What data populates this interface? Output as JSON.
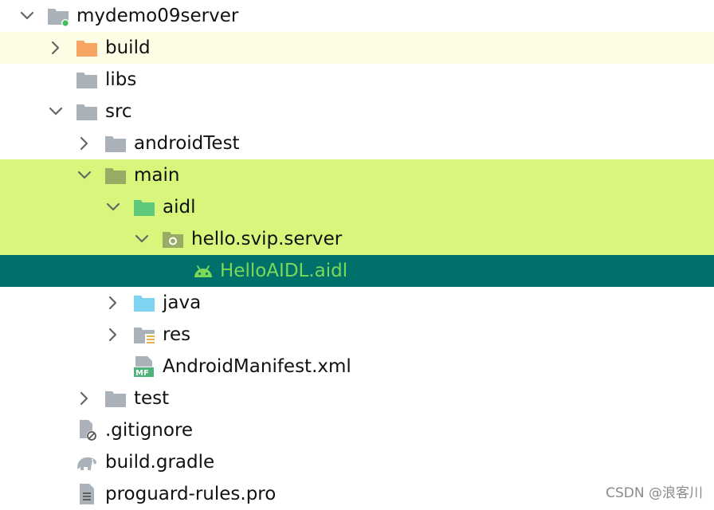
{
  "tree": {
    "rows": [
      {
        "label": "mydemo09server",
        "icon": "module-folder-icon",
        "state": "expanded"
      },
      {
        "label": "build",
        "icon": "folder-excluded-icon",
        "state": "collapsed"
      },
      {
        "label": "libs",
        "icon": "folder-icon",
        "state": "none"
      },
      {
        "label": "src",
        "icon": "folder-icon",
        "state": "expanded"
      },
      {
        "label": "androidTest",
        "icon": "folder-icon",
        "state": "collapsed"
      },
      {
        "label": "main",
        "icon": "folder-icon",
        "state": "expanded"
      },
      {
        "label": "aidl",
        "icon": "aidl-source-folder-icon",
        "state": "expanded"
      },
      {
        "label": "hello.svip.server",
        "icon": "package-icon",
        "state": "expanded"
      },
      {
        "label": "HelloAIDL.aidl",
        "icon": "android-icon",
        "state": "none",
        "selected": true
      },
      {
        "label": "java",
        "icon": "java-source-folder-icon",
        "state": "collapsed"
      },
      {
        "label": "res",
        "icon": "resources-folder-icon",
        "state": "collapsed"
      },
      {
        "label": "AndroidManifest.xml",
        "icon": "manifest-file-icon",
        "state": "none"
      },
      {
        "label": "test",
        "icon": "folder-icon",
        "state": "collapsed"
      },
      {
        "label": ".gitignore",
        "icon": "ignored-file-icon",
        "state": "none"
      },
      {
        "label": "build.gradle",
        "icon": "gradle-elephant-icon",
        "state": "none"
      },
      {
        "label": "proguard-rules.pro",
        "icon": "text-file-icon",
        "state": "none"
      }
    ]
  },
  "watermark": "CSDN @浪客川",
  "colors": {
    "folder_gray": "#aab1b8",
    "excluded_orange": "#f7a465",
    "source_green": "#5ec97a",
    "java_blue": "#7ed3f0",
    "selected_bg": "#00706b",
    "selected_text": "#7cd957",
    "highlight_green": "#d8f57c",
    "highlight_yellow": "#fdfde6"
  }
}
